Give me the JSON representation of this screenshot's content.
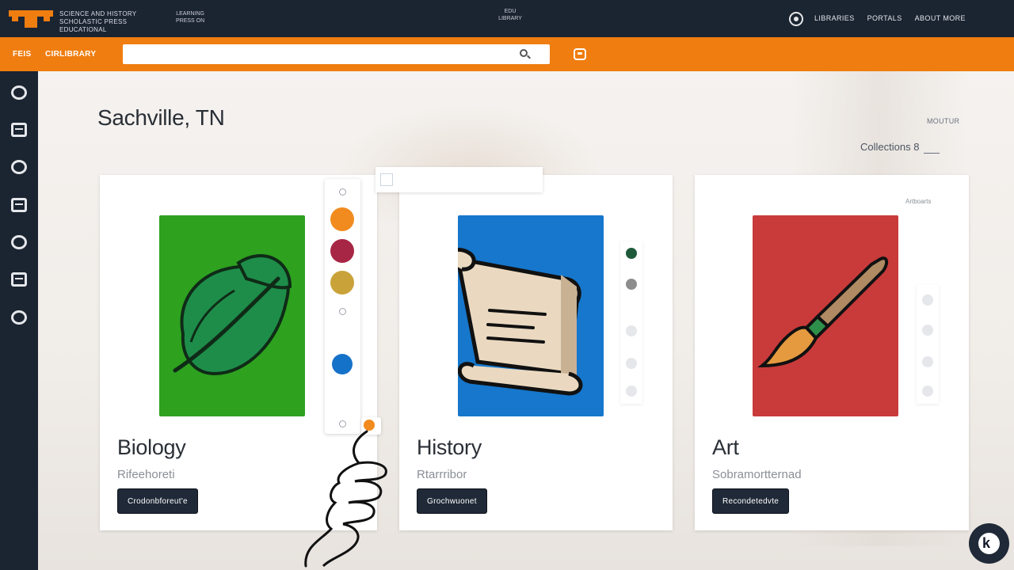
{
  "topbar": {
    "brand_line": "SCIENCE AND HISTORY\nSCHOLASTIC PRESS\nEDUCATIONAL",
    "brand_sub": "LEARNING\nPRESS ON",
    "center_title": "EDU\nLIBRARY",
    "links": [
      "LIBRARIES",
      "PORTALS",
      "ABOUT MORE"
    ]
  },
  "orangebar": {
    "item1": "FEIS",
    "item2": "CIRLIBRARY",
    "search_placeholder": ""
  },
  "main": {
    "title": "Sachville, TN",
    "meta1": "MOUTUR",
    "meta2": "Collections 8"
  },
  "cards": [
    {
      "title": "Biology",
      "subtitle": "Rifeehoreti",
      "button": "Crodonbforeut'e",
      "cover_color": "#2ea11f",
      "icon": "leaf-icon"
    },
    {
      "title": "History",
      "subtitle": "Rtarrribor",
      "button": "Grochwuonet",
      "cover_color": "#1677cc",
      "icon": "scroll-icon"
    },
    {
      "title": "Art",
      "subtitle": "Sobramortternad",
      "button": "Recondetedvte",
      "cover_color": "#c93a3a",
      "icon": "paintbrush-icon",
      "tag": "Artboarts"
    }
  ],
  "palette": {
    "swatches": [
      "#f28b1f",
      "#a82645",
      "#c9a23a",
      "#1572c9"
    ],
    "accent": "#ef7d10"
  },
  "colors": {
    "dark": "#1b2431",
    "orange": "#ef7d10"
  },
  "sidebar": {
    "icons": [
      "globe-icon",
      "calendar-icon",
      "network-icon",
      "lock-icon",
      "robot-icon",
      "calendar-icon",
      "support-icon"
    ]
  }
}
